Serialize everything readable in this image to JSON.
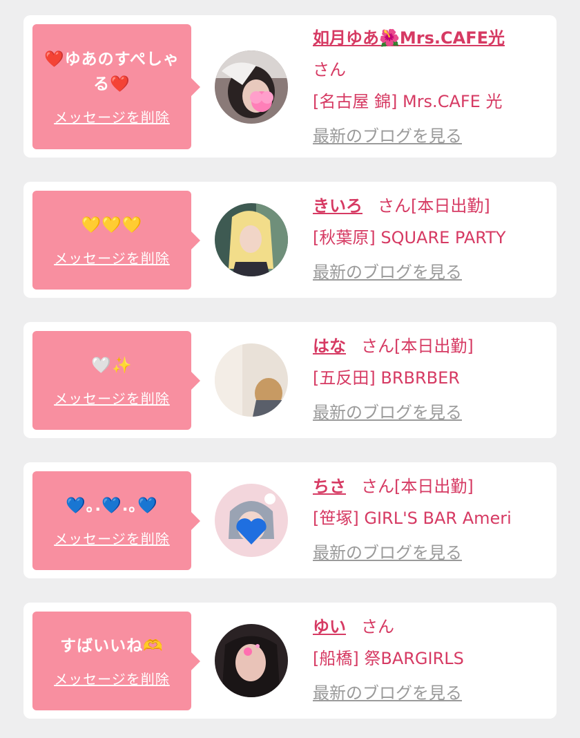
{
  "cards": [
    {
      "message": "❤️ゆあのすぺしゃる❤️",
      "delete_label": "メッセージを削除",
      "name": "如月ゆあ🌺Mrs.CAFE光",
      "honorific": "さん",
      "status": "",
      "shop": "[名古屋 錦] Mrs.CAFE 光",
      "blog_label": "最新のブログを見る"
    },
    {
      "message": "💛💛💛",
      "delete_label": "メッセージを削除",
      "name": "きいろ",
      "honorific": "さん",
      "status": "[本日出勤]",
      "shop": "[秋葉原] SQUARE PARTY",
      "blog_label": "最新のブログを見る"
    },
    {
      "message": "🤍✨",
      "delete_label": "メッセージを削除",
      "name": "はな",
      "honorific": "さん",
      "status": "[本日出勤]",
      "shop": "[五反田] BRBRBER",
      "blog_label": "最新のブログを見る"
    },
    {
      "message": "💙｡.💙.｡💙",
      "delete_label": "メッセージを削除",
      "name": "ちさ",
      "honorific": "さん",
      "status": "[本日出勤]",
      "shop": "[笹塚] GIRL'S BAR Ameri",
      "blog_label": "最新のブログを見る"
    },
    {
      "message": "すばいいね🫶",
      "delete_label": "メッセージを削除",
      "name": "ゆい",
      "honorific": "さん",
      "status": "",
      "shop": "[船橋] 祭BARGIRLS",
      "blog_label": "最新のブログを見る"
    }
  ],
  "colors": {
    "bubble": "#f88fa0",
    "name": "#d63a63",
    "link_gray": "#9a9a9a",
    "background": "#eeeeef"
  }
}
